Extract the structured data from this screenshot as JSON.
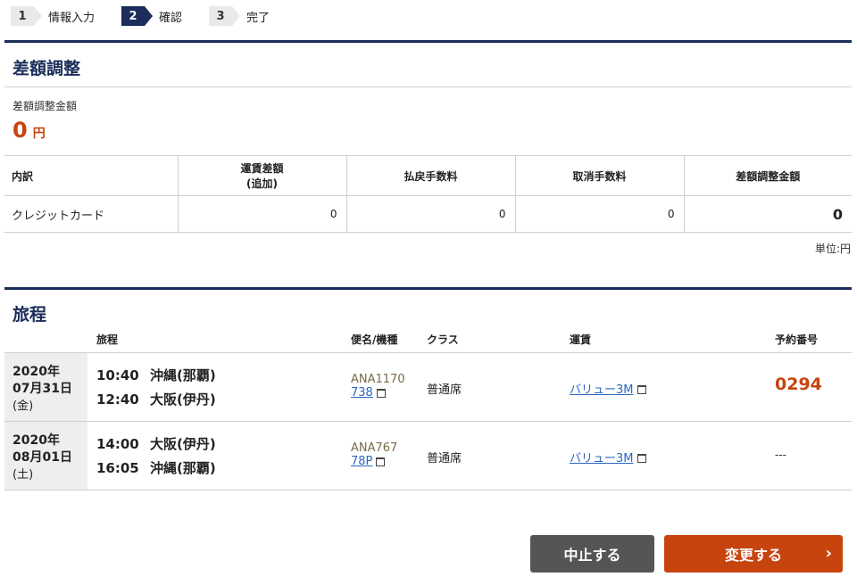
{
  "steps": [
    {
      "num": "1",
      "label": "情報入力"
    },
    {
      "num": "2",
      "label": "確認"
    },
    {
      "num": "3",
      "label": "完了"
    }
  ],
  "adjustment": {
    "title": "差額調整",
    "amount_label": "差額調整金額",
    "amount_value": "0",
    "amount_unit": "円",
    "table": {
      "headers": {
        "breakdown": "内訳",
        "fare_diff_line1": "運賃差額",
        "fare_diff_line2": "(追加)",
        "refund_fee": "払戻手数料",
        "cancel_fee": "取消手数料",
        "adjust_amount": "差額調整金額"
      },
      "row": {
        "method": "クレジットカード",
        "fare_diff": "0",
        "refund_fee": "0",
        "cancel_fee": "0",
        "adjust_amount": "0"
      }
    },
    "unit_note": "単位:円"
  },
  "itinerary": {
    "title": "旅程",
    "headers": {
      "route": "旅程",
      "flight": "便名/機種",
      "class": "クラス",
      "fare": "運賃",
      "reservation": "予約番号"
    },
    "rows": [
      {
        "year": "2020年",
        "date": "07月31日",
        "weekday": "(金)",
        "dep_time": "10:40",
        "dep_place": "沖縄(那覇)",
        "arr_time": "12:40",
        "arr_place": "大阪(伊丹)",
        "flight_no": "ANA1170",
        "aircraft": "738",
        "class": "普通席",
        "fare": "バリュー3M",
        "reservation": "0294"
      },
      {
        "year": "2020年",
        "date": "08月01日",
        "weekday": "(土)",
        "dep_time": "14:00",
        "dep_place": "大阪(伊丹)",
        "arr_time": "16:05",
        "arr_place": "沖縄(那覇)",
        "flight_no": "ANA767",
        "aircraft": "78P",
        "class": "普通席",
        "fare": "バリュー3M",
        "reservation": "---"
      }
    ]
  },
  "buttons": {
    "cancel": "中止する",
    "change": "変更する"
  },
  "colors": {
    "navy": "#1b2d5a",
    "accent_orange": "#c7440f",
    "link_blue": "#2b66c2",
    "cancel_gray": "#555555"
  },
  "icons": {
    "window": "new-window-icon",
    "chevron": "chevron-right-icon"
  }
}
